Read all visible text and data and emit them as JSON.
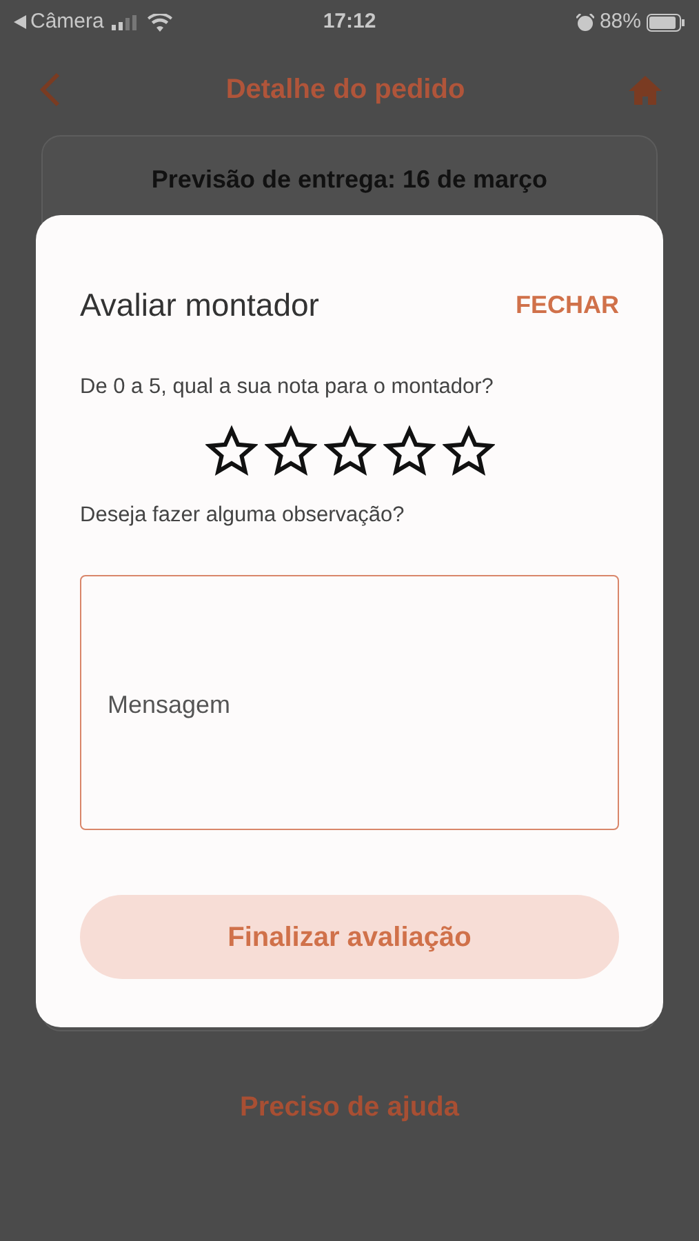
{
  "status_bar": {
    "back_app": "Câmera",
    "time": "17:12",
    "battery": "88%"
  },
  "header": {
    "title": "Detalhe do pedido"
  },
  "delivery_card": {
    "text": "Previsão de entrega: 16 de março"
  },
  "help_link": "Preciso de ajuda",
  "dialog": {
    "title": "Avaliar montador",
    "close": "FECHAR",
    "question": "De 0 a 5, qual a sua nota para o montador?",
    "rating": {
      "stars": 0
    },
    "note_question": "Deseja fazer alguma observação?",
    "message": {
      "placeholder": "Mensagem"
    },
    "submit": "Finalizar avaliação"
  }
}
